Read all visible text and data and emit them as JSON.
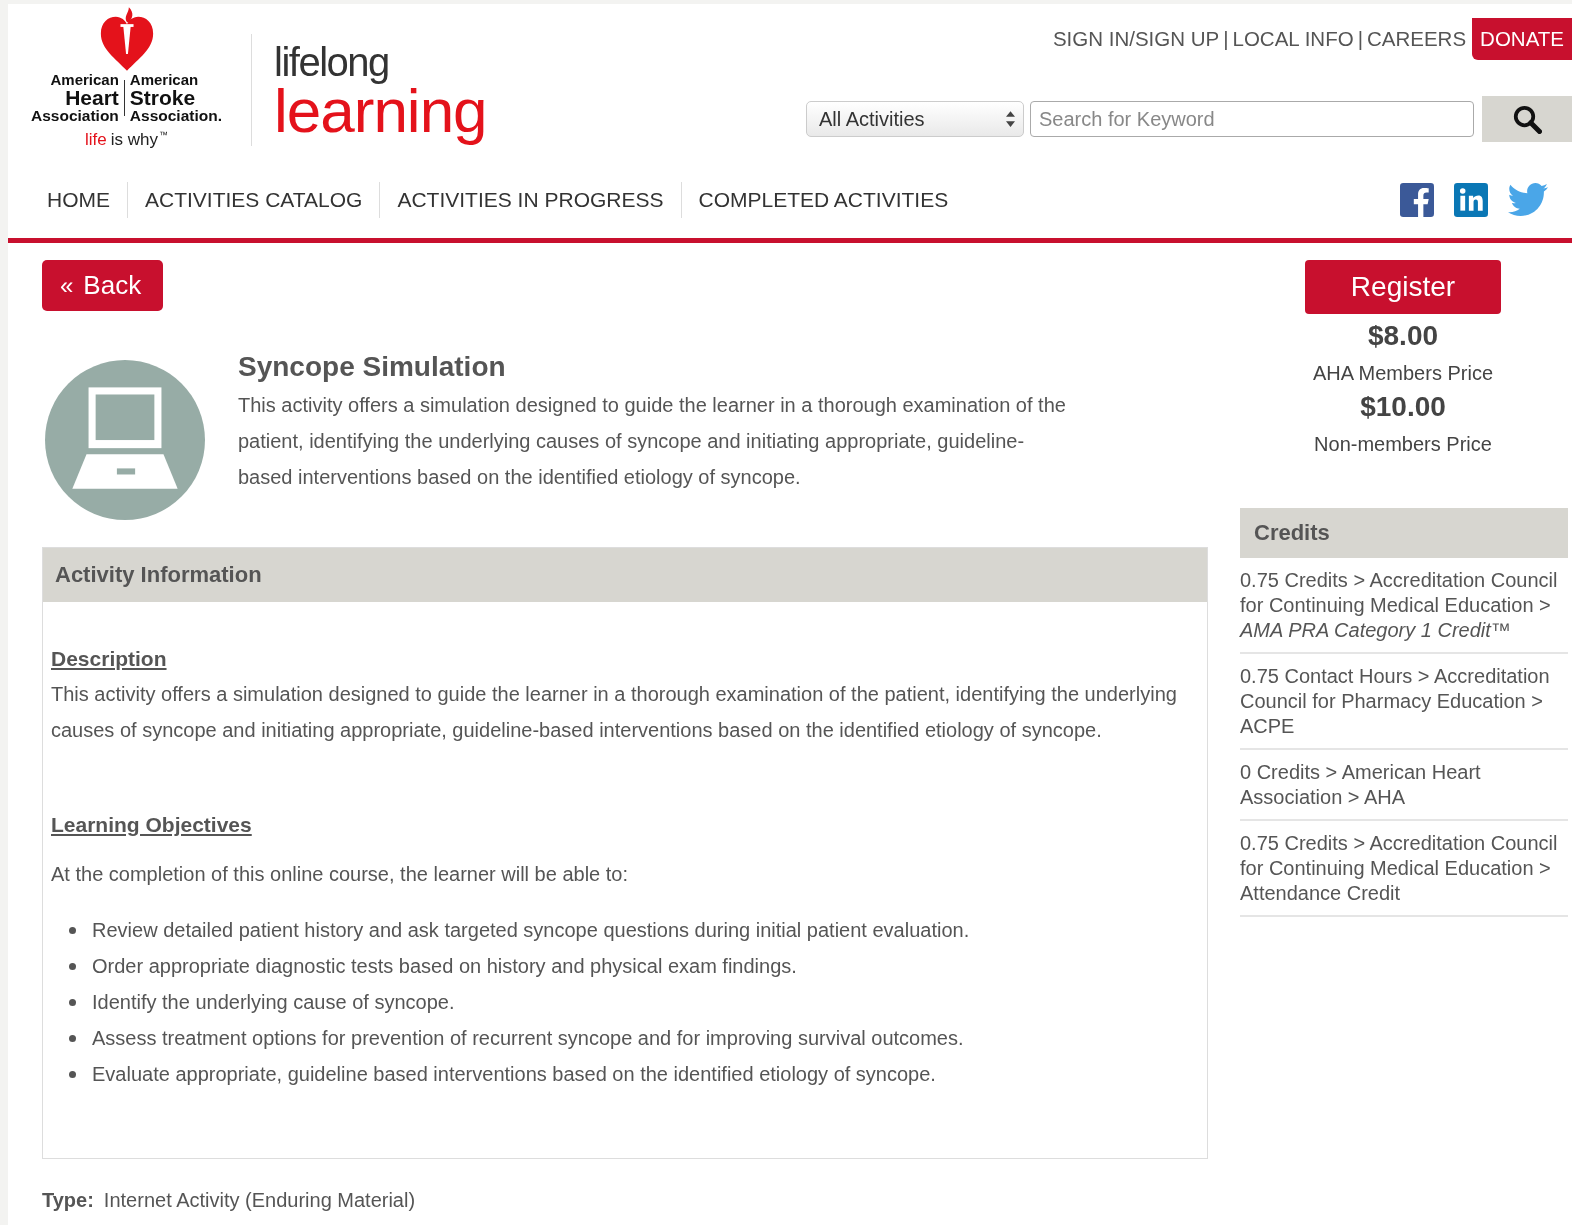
{
  "logo": {
    "left": [
      "American",
      "Heart",
      "Association"
    ],
    "right": [
      "American",
      "Stroke",
      "Association."
    ],
    "tagline_red": "life",
    "tagline_rest": "is why",
    "tagline_mark": "™",
    "product_top": "lifelong",
    "product_main": "learning"
  },
  "top_links": [
    "SIGN IN/SIGN UP",
    "|",
    "LOCAL INFO",
    "|",
    "CAREERS"
  ],
  "donate": "DONATE",
  "search": {
    "category": "All Activities",
    "placeholder": "Search for Keyword"
  },
  "nav": [
    {
      "label": "HOME",
      "selected": false
    },
    {
      "label": "ACTIVITIES CATALOG",
      "selected": false
    },
    {
      "label": "ACTIVITIES IN PROGRESS",
      "selected": false
    },
    {
      "label": "COMPLETED ACTIVITIES",
      "selected": false
    }
  ],
  "social": [
    {
      "kind": "facebook",
      "color": "#3b5998"
    },
    {
      "kind": "linkedin",
      "color": "#0a77b5"
    },
    {
      "kind": "twitter",
      "color": "#4aa6e8"
    }
  ],
  "back": {
    "icon": "«",
    "label": "Back"
  },
  "activity": {
    "title": "Syncope Simulation",
    "summary": "This activity offers a simulation designed to guide the learner in a thorough examination of the patient, identifying the underlying causes of syncope and initiating appropriate, guideline-based interventions based on the identified etiology of syncope."
  },
  "info": {
    "header": "Activity Information",
    "description_heading": "Description",
    "description": "This activity offers a simulation designed to guide the learner in a thorough examination of the patient, identifying the underlying causes of syncope and initiating appropriate, guideline-based interventions based on the identified etiology of syncope.",
    "objectives_heading": "Learning Objectives",
    "objectives_intro": "At the completion of this online course, the learner will be able to:",
    "objectives": [
      "Review detailed patient history and ask targeted syncope questions during initial patient evaluation.",
      "Order appropriate diagnostic tests based on history and physical exam findings.",
      "Identify the underlying cause of syncope.",
      "Assess treatment options for prevention of recurrent syncope and for improving survival outcomes.",
      "Evaluate appropriate, guideline based interventions based on the identified etiology of syncope."
    ]
  },
  "type": {
    "label": "Type:",
    "value": "Internet Activity (Enduring Material)"
  },
  "register": "Register",
  "prices": [
    {
      "amount": "$8.00",
      "label": "AHA Members Price"
    },
    {
      "amount": "$10.00",
      "label": "Non-members Price"
    }
  ],
  "credits": {
    "header": "Credits",
    "items": [
      "0.75 Credits > Accreditation Council for Continuing Medical Education > *AMA PRA Category 1 Credit™*",
      "0.75 Contact Hours > Accreditation Council for Pharmacy Education > ACPE",
      "0 Credits > American Heart Association > AHA",
      "0.75 Credits > Accreditation Council for Continuing Medical Education > Attendance Credit"
    ]
  }
}
